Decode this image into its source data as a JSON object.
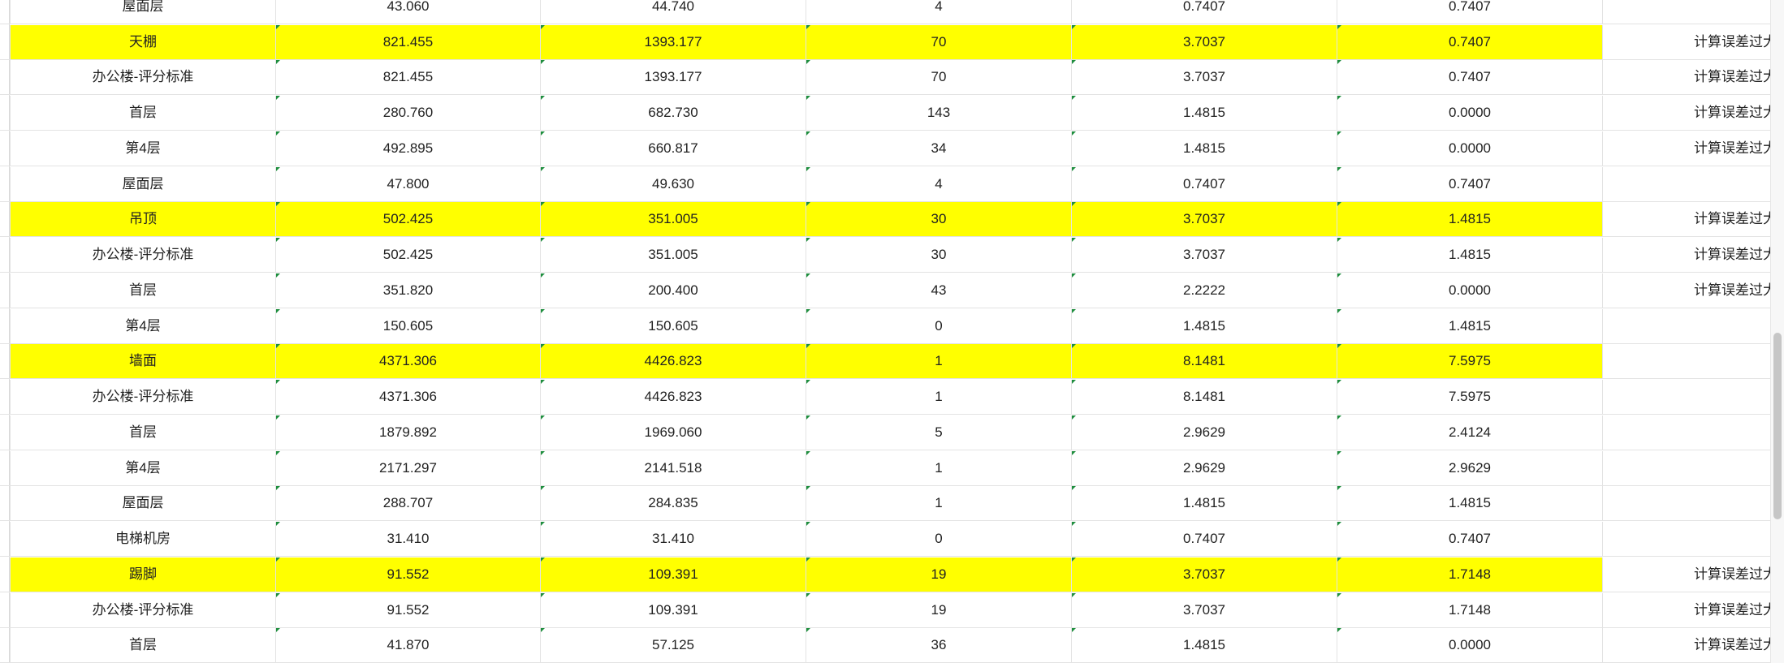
{
  "rows": [
    {
      "name": "屋面层",
      "c1": "43.060",
      "c2": "44.740",
      "c3": "4",
      "c4": "0.7407",
      "c5": "0.7407",
      "note": "",
      "highlight": false
    },
    {
      "name": "天棚",
      "c1": "821.455",
      "c2": "1393.177",
      "c3": "70",
      "c4": "3.7037",
      "c5": "0.7407",
      "note": "计算误差过大",
      "highlight": true
    },
    {
      "name": "办公楼-评分标准",
      "c1": "821.455",
      "c2": "1393.177",
      "c3": "70",
      "c4": "3.7037",
      "c5": "0.7407",
      "note": "计算误差过大",
      "highlight": false
    },
    {
      "name": "首层",
      "c1": "280.760",
      "c2": "682.730",
      "c3": "143",
      "c4": "1.4815",
      "c5": "0.0000",
      "note": "计算误差过大",
      "highlight": false
    },
    {
      "name": "第4层",
      "c1": "492.895",
      "c2": "660.817",
      "c3": "34",
      "c4": "1.4815",
      "c5": "0.0000",
      "note": "计算误差过大",
      "highlight": false
    },
    {
      "name": "屋面层",
      "c1": "47.800",
      "c2": "49.630",
      "c3": "4",
      "c4": "0.7407",
      "c5": "0.7407",
      "note": "",
      "highlight": false
    },
    {
      "name": "吊顶",
      "c1": "502.425",
      "c2": "351.005",
      "c3": "30",
      "c4": "3.7037",
      "c5": "1.4815",
      "note": "计算误差过大",
      "highlight": true
    },
    {
      "name": "办公楼-评分标准",
      "c1": "502.425",
      "c2": "351.005",
      "c3": "30",
      "c4": "3.7037",
      "c5": "1.4815",
      "note": "计算误差过大",
      "highlight": false
    },
    {
      "name": "首层",
      "c1": "351.820",
      "c2": "200.400",
      "c3": "43",
      "c4": "2.2222",
      "c5": "0.0000",
      "note": "计算误差过大",
      "highlight": false
    },
    {
      "name": "第4层",
      "c1": "150.605",
      "c2": "150.605",
      "c3": "0",
      "c4": "1.4815",
      "c5": "1.4815",
      "note": "",
      "highlight": false
    },
    {
      "name": "墙面",
      "c1": "4371.306",
      "c2": "4426.823",
      "c3": "1",
      "c4": "8.1481",
      "c5": "7.5975",
      "note": "",
      "highlight": true
    },
    {
      "name": "办公楼-评分标准",
      "c1": "4371.306",
      "c2": "4426.823",
      "c3": "1",
      "c4": "8.1481",
      "c5": "7.5975",
      "note": "",
      "highlight": false
    },
    {
      "name": "首层",
      "c1": "1879.892",
      "c2": "1969.060",
      "c3": "5",
      "c4": "2.9629",
      "c5": "2.4124",
      "note": "",
      "highlight": false
    },
    {
      "name": "第4层",
      "c1": "2171.297",
      "c2": "2141.518",
      "c3": "1",
      "c4": "2.9629",
      "c5": "2.9629",
      "note": "",
      "highlight": false
    },
    {
      "name": "屋面层",
      "c1": "288.707",
      "c2": "284.835",
      "c3": "1",
      "c4": "1.4815",
      "c5": "1.4815",
      "note": "",
      "highlight": false
    },
    {
      "name": "电梯机房",
      "c1": "31.410",
      "c2": "31.410",
      "c3": "0",
      "c4": "0.7407",
      "c5": "0.7407",
      "note": "",
      "highlight": false
    },
    {
      "name": "踢脚",
      "c1": "91.552",
      "c2": "109.391",
      "c3": "19",
      "c4": "3.7037",
      "c5": "1.7148",
      "note": "计算误差过大",
      "highlight": true
    },
    {
      "name": "办公楼-评分标准",
      "c1": "91.552",
      "c2": "109.391",
      "c3": "19",
      "c4": "3.7037",
      "c5": "1.7148",
      "note": "计算误差过大",
      "highlight": false
    },
    {
      "name": "首层",
      "c1": "41.870",
      "c2": "57.125",
      "c3": "36",
      "c4": "1.4815",
      "c5": "0.0000",
      "note": "计算误差过大",
      "highlight": false
    }
  ],
  "colors": {
    "highlight": "#ffff00",
    "grid": "#e3e3e3",
    "comment_marker": "#1e8e3e"
  }
}
